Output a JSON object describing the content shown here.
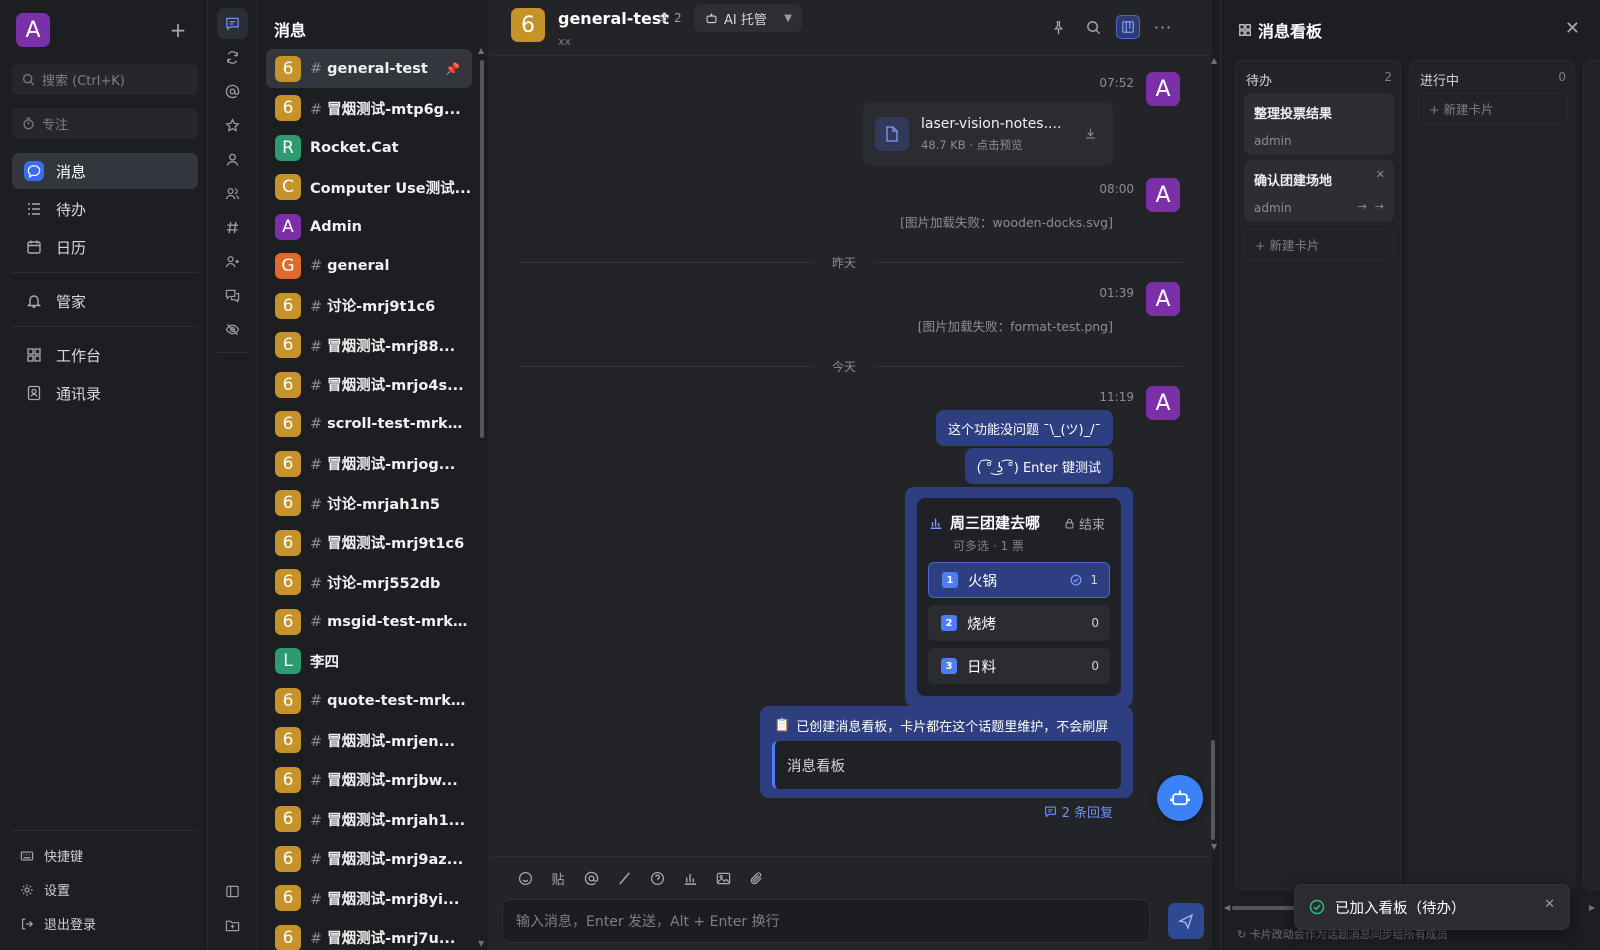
{
  "user_avatar": "A",
  "nav": {
    "search_placeholder": "搜索 (Ctrl+K)",
    "focus_label": "专注",
    "items": [
      {
        "label": "消息",
        "icon": "chat-icon"
      },
      {
        "label": "待办",
        "icon": "todo-list-icon"
      },
      {
        "label": "日历",
        "icon": "calendar-icon"
      },
      {
        "label": "管家",
        "icon": "bell-icon"
      },
      {
        "label": "工作台",
        "icon": "grid-icon"
      },
      {
        "label": "通讯录",
        "icon": "contacts-icon"
      }
    ],
    "bottom": [
      {
        "label": "快捷键",
        "icon": "keyboard-icon"
      },
      {
        "label": "设置",
        "icon": "gear-icon"
      },
      {
        "label": "退出登录",
        "icon": "logout-icon"
      }
    ]
  },
  "conversations": {
    "title": "消息",
    "items": [
      {
        "avatar": "6",
        "name": "general-test",
        "channel": true,
        "color": "#c6922a",
        "pinned": true
      },
      {
        "avatar": "6",
        "name": "冒烟测试-mtp6g...",
        "channel": true,
        "color": "#c6922a"
      },
      {
        "avatar": "R",
        "name": "Rocket.Cat",
        "channel": false,
        "color": "#2e9a6f"
      },
      {
        "avatar": "C",
        "name": "Computer Use测试...",
        "channel": false,
        "color": "#c6922a"
      },
      {
        "avatar": "A",
        "name": "Admin",
        "channel": false,
        "color": "#7b2fa8",
        "online": true
      },
      {
        "avatar": "G",
        "name": "general",
        "channel": true,
        "color": "#e06a2b"
      },
      {
        "avatar": "6",
        "name": "讨论-mrj9t1c6",
        "channel": true,
        "color": "#c6922a"
      },
      {
        "avatar": "6",
        "name": "冒烟测试-mrj88...",
        "channel": true,
        "color": "#c6922a"
      },
      {
        "avatar": "6",
        "name": "冒烟测试-mrjo4s...",
        "channel": true,
        "color": "#c6922a"
      },
      {
        "avatar": "6",
        "name": "scroll-test-mrkd...",
        "channel": true,
        "color": "#c6922a"
      },
      {
        "avatar": "6",
        "name": "冒烟测试-mrjog...",
        "channel": true,
        "color": "#c6922a"
      },
      {
        "avatar": "6",
        "name": "讨论-mrjah1n5",
        "channel": true,
        "color": "#c6922a"
      },
      {
        "avatar": "6",
        "name": "冒烟测试-mrj9t1c6",
        "channel": true,
        "color": "#c6922a"
      },
      {
        "avatar": "6",
        "name": "讨论-mrj552db",
        "channel": true,
        "color": "#c6922a"
      },
      {
        "avatar": "6",
        "name": "msgid-test-mrki...",
        "channel": true,
        "color": "#c6922a"
      },
      {
        "avatar": "L",
        "name": "李四",
        "channel": false,
        "color": "#2e9a6f"
      },
      {
        "avatar": "6",
        "name": "quote-test-mrkd...",
        "channel": true,
        "color": "#c6922a"
      },
      {
        "avatar": "6",
        "name": "冒烟测试-mrjen...",
        "channel": true,
        "color": "#c6922a"
      },
      {
        "avatar": "6",
        "name": "冒烟测试-mrjbw...",
        "channel": true,
        "color": "#c6922a"
      },
      {
        "avatar": "6",
        "name": "冒烟测试-mrjah1...",
        "channel": true,
        "color": "#c6922a"
      },
      {
        "avatar": "6",
        "name": "冒烟测试-mrj9az...",
        "channel": true,
        "color": "#c6922a"
      },
      {
        "avatar": "6",
        "name": "冒烟测试-mrj8yi...",
        "channel": true,
        "color": "#c6922a"
      },
      {
        "avatar": "6",
        "name": "冒烟测试-mrj7u...",
        "channel": true,
        "color": "#c6922a"
      }
    ]
  },
  "chat": {
    "avatar": "6",
    "title": "general-test",
    "subtitle": "xx",
    "members": "2",
    "ai_label": "AI 托管",
    "messages": {
      "t1": "07:52",
      "file_name": "laser-vision-notes....",
      "file_meta": "48.7 KB · 点击预览",
      "t2": "08:00",
      "fail1": "[图片加载失败：wooden-docks.svg]",
      "yesterday": "昨天",
      "t3": "01:39",
      "fail2": "[图片加载失败：format-test.png]",
      "today": "今天",
      "t4": "11:19",
      "bubble1": "这个功能没问题 ¯\\_(ツ)_/¯",
      "bubble2": "( ͡° ͜ʖ ͡°) Enter 键测试",
      "poll": {
        "title": "周三团建去哪",
        "end_label": "结束",
        "sub": "可多选 · 1 票",
        "options": [
          {
            "num": "1",
            "label": "火锅",
            "count": "1",
            "voted": true
          },
          {
            "num": "2",
            "label": "烧烤",
            "count": "0",
            "voted": false
          },
          {
            "num": "3",
            "label": "日料",
            "count": "0",
            "voted": false
          }
        ]
      },
      "board_notice": "已创建消息看板，卡片都在这个话题里维护，不会刷屏",
      "board_quote": "消息看板",
      "replies": "2 条回复"
    },
    "composer_placeholder": "输入消息，Enter 发送，Alt + Enter 换行",
    "paste_tool": "贴"
  },
  "board": {
    "title": "消息看板",
    "columns": [
      {
        "name": "待办",
        "count": "2",
        "cards": [
          {
            "title": "整理投票结果",
            "owner": "admin"
          },
          {
            "title": "确认团建场地",
            "owner": "admin"
          }
        ],
        "new_label": "+ 新建卡片"
      },
      {
        "name": "进行中",
        "count": "0",
        "cards": [],
        "new_label": "+ 新建卡片"
      }
    ],
    "footnote": "卡片改动会作为话题消息同步给所有成员",
    "toast": "已加入看板（待办）"
  }
}
